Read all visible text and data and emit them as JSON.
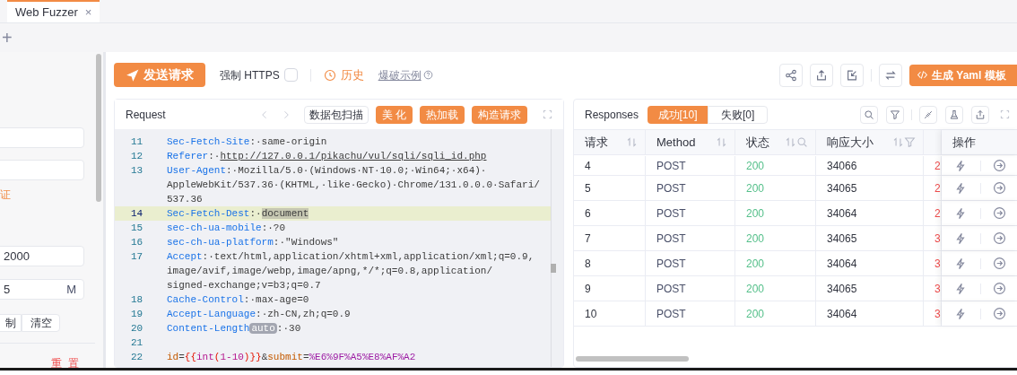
{
  "tabs": [
    {
      "label": "Web Fuzzer",
      "selected": true,
      "close": "×"
    }
  ],
  "new_tab": "+",
  "sidebar": {
    "items": [
      {
        "kind": "field"
      },
      {
        "kind": "field"
      },
      {
        "kind": "link",
        "text": "证"
      },
      {
        "kind": "field",
        "value": "2000"
      },
      {
        "kind": "field",
        "value": "5",
        "suffix": "M"
      },
      {
        "kind": "buttons",
        "buttons": [
          "制",
          "清空"
        ]
      },
      {
        "kind": "reset",
        "text": "重 置"
      }
    ]
  },
  "toolbar": {
    "send": "发送请求",
    "force_https": {
      "label": "强制 HTTPS",
      "checked": false
    },
    "history": "历史",
    "example": "爆破示例",
    "generate": "生成 Yaml 模板"
  },
  "request": {
    "title": "Request",
    "buttons": [
      {
        "label": "数据包扫描",
        "kind": "plain"
      },
      {
        "label": "美 化",
        "kind": "primary"
      },
      {
        "label": "热加载",
        "kind": "primary"
      },
      {
        "label": "构造请求",
        "kind": "primary"
      }
    ],
    "lines": [
      {
        "number": "11",
        "highlighted": false,
        "rows": [
          [
            {
              "kind": "key",
              "text": "Sec-Fetch-Site"
            },
            {
              "kind": "plain",
              "text": ":·same-origin"
            }
          ]
        ]
      },
      {
        "number": "12",
        "highlighted": false,
        "rows": [
          [
            {
              "kind": "key",
              "text": "Referer"
            },
            {
              "kind": "plain",
              "text": ":·"
            },
            {
              "kind": "link",
              "text": "http://127.0.0.1/pikachu/vul/sqli/sqli_id.php"
            }
          ]
        ]
      },
      {
        "number": "13",
        "highlighted": false,
        "rows": [
          [
            {
              "kind": "key",
              "text": "User-Agent"
            },
            {
              "kind": "plain",
              "text": ":·Mozilla/5.0·(Windows·NT·10.0;·Win64;·x64)·"
            }
          ],
          [
            {
              "kind": "plain",
              "text": "AppleWebKit/537.36·(KHTML,·like·Gecko)·Chrome/131.0.0.0·Safari/"
            }
          ],
          [
            {
              "kind": "plain",
              "text": "537.36"
            }
          ]
        ]
      },
      {
        "number": "14",
        "highlighted": true,
        "rows": [
          [
            {
              "kind": "key",
              "text": "Sec-Fetch-Dest"
            },
            {
              "kind": "plain",
              "text": ":·"
            },
            {
              "kind": "selection",
              "text": "document"
            }
          ]
        ]
      },
      {
        "number": "15",
        "highlighted": false,
        "rows": [
          [
            {
              "kind": "key",
              "text": "sec-ch-ua-mobile"
            },
            {
              "kind": "plain",
              "text": ":·?0"
            }
          ]
        ]
      },
      {
        "number": "16",
        "highlighted": false,
        "rows": [
          [
            {
              "kind": "key",
              "text": "sec-ch-ua-platform"
            },
            {
              "kind": "plain",
              "text": ":·\"Windows\""
            }
          ]
        ]
      },
      {
        "number": "17",
        "highlighted": false,
        "rows": [
          [
            {
              "kind": "key",
              "text": "Accept"
            },
            {
              "kind": "plain",
              "text": ":·text/html,application/xhtml+xml,application/xml;q=0.9,"
            }
          ],
          [
            {
              "kind": "plain",
              "text": "image/avif,image/webp,image/apng,*/*;q=0.8,application/"
            }
          ],
          [
            {
              "kind": "plain",
              "text": "signed-exchange;v=b3;q=0.7"
            }
          ]
        ]
      },
      {
        "number": "18",
        "highlighted": false,
        "rows": [
          [
            {
              "kind": "key",
              "text": "Cache-Control"
            },
            {
              "kind": "plain",
              "text": ":·max-age=0"
            }
          ]
        ]
      },
      {
        "number": "19",
        "highlighted": false,
        "rows": [
          [
            {
              "kind": "key",
              "text": "Accept-Language"
            },
            {
              "kind": "plain",
              "text": ":·zh-CN,zh;q=0.9"
            }
          ]
        ]
      },
      {
        "number": "20",
        "highlighted": false,
        "rows": [
          [
            {
              "kind": "key",
              "text": "Content-Length"
            },
            {
              "kind": "tag",
              "text": "auto"
            },
            {
              "kind": "plain",
              "text": ":·30"
            }
          ]
        ]
      },
      {
        "number": "21",
        "highlighted": false,
        "rows": [
          []
        ]
      },
      {
        "number": "22",
        "highlighted": false,
        "rows": [
          [
            {
              "kind": "param",
              "text": "id"
            },
            {
              "kind": "plain",
              "text": "="
            },
            {
              "kind": "brace",
              "text": "{{"
            },
            {
              "kind": "func",
              "text": "int"
            },
            {
              "kind": "brace",
              "text": "("
            },
            {
              "kind": "func",
              "text": "1-10"
            },
            {
              "kind": "brace",
              "text": ")}}"
            },
            {
              "kind": "plain",
              "text": "&"
            },
            {
              "kind": "param",
              "text": "submit"
            },
            {
              "kind": "plain",
              "text": "="
            },
            {
              "kind": "encoded",
              "text": "%E6%9F%A5%E8%AF%A2"
            }
          ]
        ]
      }
    ]
  },
  "responses": {
    "title": "Responses",
    "filters": [
      {
        "label": "成功[10]",
        "selected": true
      },
      {
        "label": "失败[0]",
        "selected": false
      }
    ],
    "columns": [
      {
        "label": "请求",
        "controls": [
          {
            "kind": "sort"
          }
        ]
      },
      {
        "label": "Method",
        "controls": [
          {
            "kind": "sort"
          }
        ]
      },
      {
        "label": "状态",
        "controls": [
          {
            "kind": "sort"
          },
          {
            "kind": "search"
          }
        ]
      },
      {
        "label": "响应大小",
        "controls": [
          {
            "kind": "sort"
          },
          {
            "kind": "filter"
          }
        ]
      }
    ],
    "actions_column": "操作",
    "rows": [
      {
        "request": "4",
        "method": "POST",
        "status": "200",
        "size": "34066",
        "delay": "2"
      },
      {
        "request": "5",
        "method": "POST",
        "status": "200",
        "size": "34065",
        "delay": "2"
      },
      {
        "request": "6",
        "method": "POST",
        "status": "200",
        "size": "34064",
        "delay": "2"
      },
      {
        "request": "7",
        "method": "POST",
        "status": "200",
        "size": "34065",
        "delay": "3"
      },
      {
        "request": "8",
        "method": "POST",
        "status": "200",
        "size": "34064",
        "delay": "3"
      },
      {
        "request": "9",
        "method": "POST",
        "status": "200",
        "size": "34065",
        "delay": "3"
      },
      {
        "request": "10",
        "method": "POST",
        "status": "200",
        "size": "34064",
        "delay": "3"
      }
    ]
  }
}
